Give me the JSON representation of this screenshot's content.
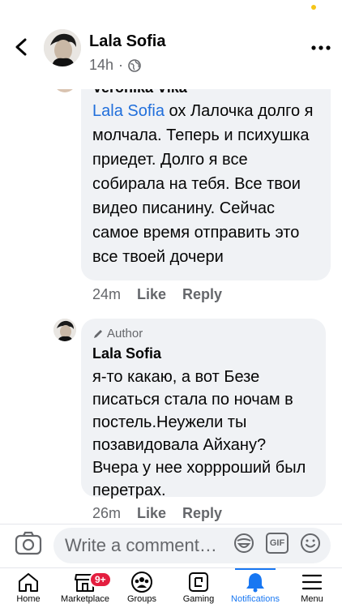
{
  "header": {
    "name": "Lala Sofia",
    "time": "14h",
    "separator": "·"
  },
  "comments": [
    {
      "author": "Veronika Vika",
      "mention": "Lala Sofia",
      "text": " ох Лалочка долго я молчала. Теперь и психушка приедет. Долго я все собирала на тебя. Все твои видео писанину. Сейчас самое время отправить это все твоей дочери",
      "time": "24m",
      "like": "Like",
      "reply": "Reply"
    },
    {
      "badge": "Author",
      "author": "Lala Sofia",
      "text": "я-то какаю, а вот Безе писаться стала по ночам в постель.Неужели ты позавидовала Айхану? Вчера у нее хоррроший был перетрах.",
      "time": "26m",
      "like": "Like",
      "reply": "Reply"
    }
  ],
  "composer": {
    "placeholder": "Write a comment…",
    "gif": "GIF"
  },
  "tabs": [
    {
      "label": "Home",
      "icon": "home-icon"
    },
    {
      "label": "Marketplace",
      "icon": "marketplace-icon",
      "badge": "9+"
    },
    {
      "label": "Groups",
      "icon": "groups-icon"
    },
    {
      "label": "Gaming",
      "icon": "gaming-icon"
    },
    {
      "label": "Notifications",
      "icon": "bell-icon",
      "active": true
    },
    {
      "label": "Menu",
      "icon": "menu-icon"
    }
  ],
  "colors": {
    "accent": "#1877f2",
    "mention": "#216fdb",
    "bubble": "#f0f2f5",
    "badge": "#e41e3f"
  }
}
